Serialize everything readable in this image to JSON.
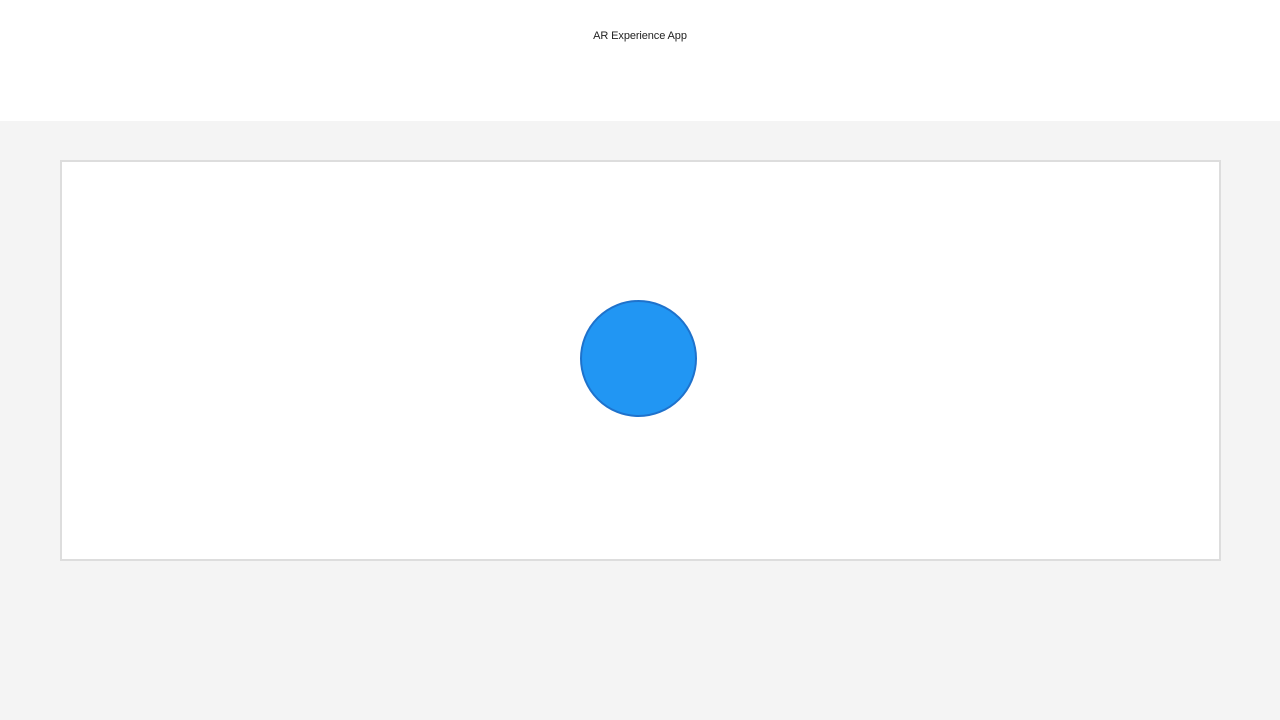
{
  "header": {
    "title": "AR Experience App"
  },
  "viewport": {
    "object": {
      "shape": "circle",
      "fill_color": "#2196f3",
      "border_color": "#1e72cc"
    }
  },
  "colors": {
    "page_background": "#f4f4f4",
    "header_background": "#ffffff",
    "viewport_border": "#dddddd"
  }
}
